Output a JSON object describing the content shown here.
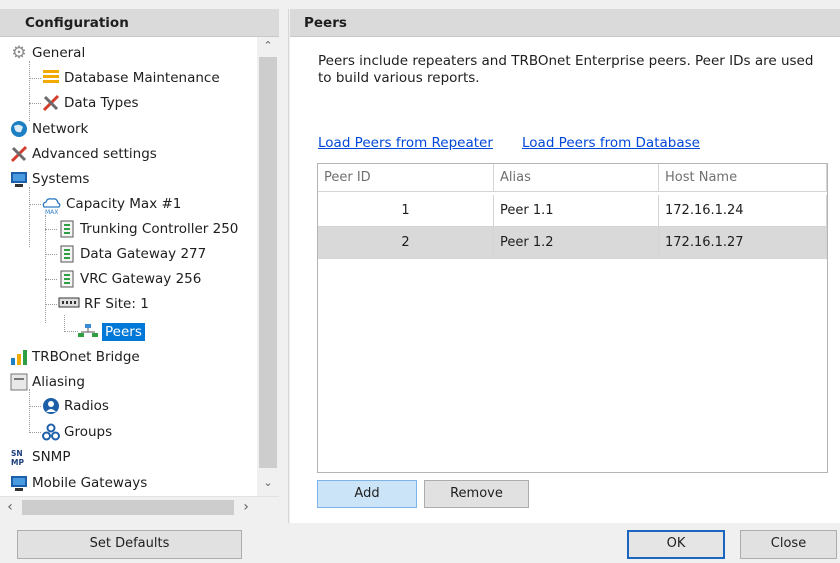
{
  "left_panel": {
    "title": "Configuration",
    "tree": [
      {
        "label": "General",
        "icon": "gear-icon"
      },
      {
        "label": "Database Maintenance",
        "icon": "database-icon"
      },
      {
        "label": "Data Types",
        "icon": "wrench-icon"
      },
      {
        "label": "Network",
        "icon": "globe-icon"
      },
      {
        "label": "Advanced settings",
        "icon": "tools-icon"
      },
      {
        "label": "Systems",
        "icon": "computer-icon"
      },
      {
        "label": "Capacity Max #1",
        "icon": "cloud-max-icon"
      },
      {
        "label": "Trunking Controller 250",
        "icon": "server-icon"
      },
      {
        "label": "Data Gateway 277",
        "icon": "server-icon"
      },
      {
        "label": "VRC Gateway 256",
        "icon": "server-icon"
      },
      {
        "label": "RF Site: 1",
        "icon": "rack-icon"
      },
      {
        "label": "Peers",
        "icon": "network-icon"
      },
      {
        "label": "TRBOnet Bridge",
        "icon": "bars-icon"
      },
      {
        "label": "Aliasing",
        "icon": "document-icon"
      },
      {
        "label": "Radios",
        "icon": "user-icon"
      },
      {
        "label": "Groups",
        "icon": "group-icon"
      },
      {
        "label": "SNMP",
        "icon": "snmp-icon"
      },
      {
        "label": "Mobile Gateways",
        "icon": "monitor-icon"
      }
    ],
    "selected": "Peers",
    "set_defaults_label": "Set Defaults"
  },
  "right_panel": {
    "title": "Peers",
    "description": "Peers include repeaters and TRBOnet Enterprise peers. Peer IDs are used to build various reports.",
    "links": {
      "load_from_repeater": "Load Peers from Repeater",
      "load_from_database": "Load Peers from Database"
    },
    "table": {
      "headers": {
        "peer_id": "Peer ID",
        "alias": "Alias",
        "host": "Host Name"
      },
      "rows": [
        {
          "peer_id": "1",
          "alias": "Peer 1.1",
          "host": "172.16.1.24"
        },
        {
          "peer_id": "2",
          "alias": "Peer 1.2",
          "host": "172.16.1.27"
        }
      ]
    },
    "add_label": "Add",
    "remove_label": "Remove"
  },
  "footer": {
    "ok_label": "OK",
    "close_label": "Close"
  },
  "colors": {
    "selection": "#0078d7",
    "link": "#0048d9",
    "header_bg": "#dadada",
    "alt_row": "#d9d9d9",
    "default_button_border": "#1d66c0"
  }
}
